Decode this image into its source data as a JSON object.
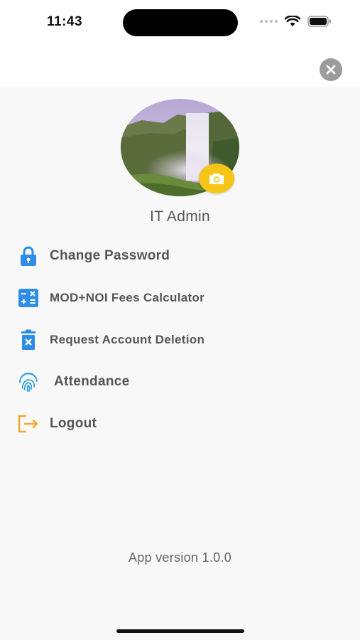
{
  "status_bar": {
    "time": "11:43"
  },
  "header": {
    "close_icon": "close-circle-icon"
  },
  "profile": {
    "avatar_description": "waterfall-photo",
    "camera_icon": "camera-icon",
    "name": "IT Admin"
  },
  "menu": {
    "items": [
      {
        "label": "Change Password",
        "icon": "lock-icon",
        "color": "#2e8de6"
      },
      {
        "label": "MOD+NOI Fees Calculator",
        "icon": "calculator-icon",
        "color": "#2e8de6"
      },
      {
        "label": "Request Account Deletion",
        "icon": "delete-account-icon",
        "color": "#2e8de6"
      },
      {
        "label": "Attendance",
        "icon": "fingerprint-icon",
        "color": "#3aa0e0"
      },
      {
        "label": "Logout",
        "icon": "logout-icon",
        "color": "#f0a830"
      }
    ]
  },
  "footer": {
    "version": "App version 1.0.0"
  },
  "colors": {
    "accent_blue": "#2e8de6",
    "accent_yellow": "#f5c518",
    "logout_orange": "#f0a830",
    "background": "#f8f8f8"
  }
}
